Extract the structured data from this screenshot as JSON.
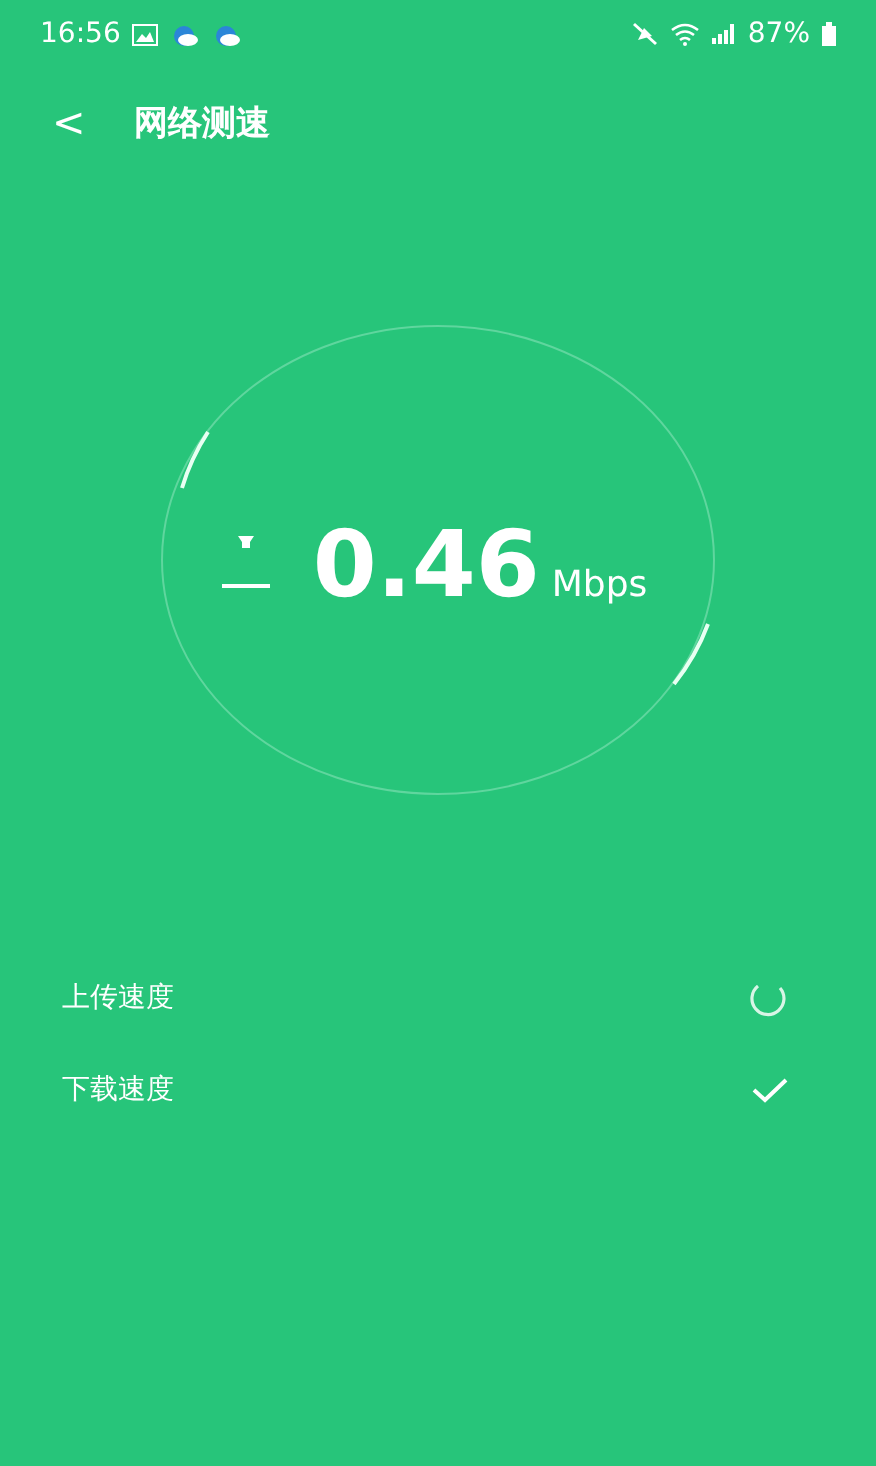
{
  "status_bar": {
    "time": "16:56",
    "battery": "87%"
  },
  "header": {
    "back": "<",
    "title": "网络测速"
  },
  "speed": {
    "value": "0.46",
    "unit": "Mbps"
  },
  "tests": [
    {
      "label": "上传速度",
      "done": false
    },
    {
      "label": "下载速度",
      "done": true
    }
  ]
}
